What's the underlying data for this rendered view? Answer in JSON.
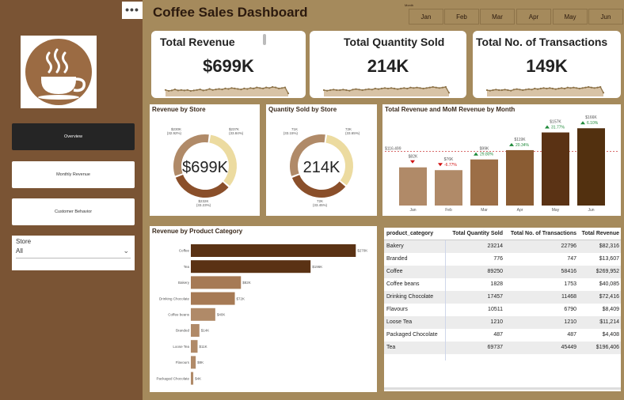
{
  "app": {
    "title": "Coffee Sales Dashboard"
  },
  "sidebar": {
    "menu_glyph": "•••",
    "logo_icon": "coffee-cup-icon",
    "nav": [
      {
        "label": "Overview",
        "active": true
      },
      {
        "label": "Monthly Revenue",
        "active": false
      },
      {
        "label": "Customer Behavior",
        "active": false
      }
    ],
    "store_filter": {
      "label": "Store",
      "value": "All"
    }
  },
  "month_slicer": {
    "label": "Month",
    "months": [
      "Jan",
      "Feb",
      "Mar",
      "Apr",
      "May",
      "Jun"
    ]
  },
  "kpis": [
    {
      "title": "Total Revenue",
      "value": "$699K"
    },
    {
      "title": "Total Quantity Sold",
      "value": "214K"
    },
    {
      "title": "Total No. of Transactions",
      "value": "149K"
    }
  ],
  "colors": {
    "dark": "#5a3214",
    "mid": "#8a4f2a",
    "light_brown": "#b08a68",
    "cream": "#ecdba0",
    "accent_bg": "#a58a5c",
    "sidebar": "#7a5434",
    "up": "#1f8a3a",
    "down": "#d01010"
  },
  "chart_data": [
    {
      "type": "pie",
      "title": "Revenue by Store",
      "center_label": "$699K",
      "slices": [
        {
          "value": 237,
          "label": "$237K",
          "pct_label": "(33.84%)"
        },
        {
          "value": 232,
          "label": "$232K",
          "pct_label": "(33.23%)"
        },
        {
          "value": 230,
          "label": "$230K",
          "pct_label": "(32.92%)"
        }
      ]
    },
    {
      "type": "pie",
      "title": "Quantity Sold by Store",
      "center_label": "214K",
      "slices": [
        {
          "value": 72,
          "label": "72K",
          "pct_label": "(33.65%)"
        },
        {
          "value": 72,
          "label": "72K",
          "pct_label": "(33.45%)"
        },
        {
          "value": 71,
          "label": "71K",
          "pct_label": "(33.15%)"
        }
      ]
    },
    {
      "type": "bar",
      "title": "Total Revenue and MoM Revenue by Month",
      "categories": [
        "Jan",
        "Feb",
        "Mar",
        "Apr",
        "May",
        "Jun"
      ],
      "values": [
        82,
        76,
        99,
        119,
        157,
        166
      ],
      "value_labels": [
        "$82K",
        "$76K",
        "$99K",
        "$119K",
        "$157K",
        "$166K"
      ],
      "mom": [
        {
          "dir": "down",
          "text": ""
        },
        {
          "dir": "down",
          "text": "-6.77%"
        },
        {
          "dir": "up",
          "text": "29.80%"
        },
        {
          "dir": "up",
          "text": "20.34%"
        },
        {
          "dir": "up",
          "text": "31.77%"
        },
        {
          "dir": "up",
          "text": "6.10%"
        }
      ],
      "reference_value": 116.499,
      "reference_label": "$116.499",
      "ylim": [
        0,
        180
      ]
    },
    {
      "type": "bar",
      "orientation": "horizontal",
      "title": "Revenue by Product Category",
      "categories": [
        "Coffee",
        "Tea",
        "Bakery",
        "Drinking Chocolate",
        "Coffee beans",
        "Branded",
        "Loose Tea",
        "Flavours",
        "Packaged Chocolate"
      ],
      "values": [
        270,
        196,
        82,
        72,
        40,
        14,
        11,
        8,
        4
      ],
      "value_labels": [
        "$270K",
        "$196K",
        "$82K",
        "$72K",
        "$40K",
        "$14K",
        "$11K",
        "$8K",
        "$4K"
      ],
      "xlim": [
        0,
        280
      ]
    },
    {
      "type": "line",
      "role": "kpi-sparkline",
      "kpi": "Total Revenue",
      "values": [
        10,
        8,
        9,
        11,
        9,
        10,
        9,
        10,
        8,
        9,
        10,
        11,
        9,
        10,
        12,
        10,
        11,
        12,
        11,
        13,
        12,
        14,
        13,
        12,
        11,
        13,
        12,
        14,
        13,
        15,
        14,
        13,
        15,
        14,
        16,
        15,
        13,
        14,
        15,
        3
      ]
    },
    {
      "type": "line",
      "role": "kpi-sparkline",
      "kpi": "Total Quantity Sold",
      "values": [
        9,
        8,
        9,
        10,
        9,
        9,
        10,
        9,
        8,
        10,
        11,
        10,
        9,
        10,
        11,
        10,
        12,
        11,
        12,
        13,
        12,
        13,
        12,
        11,
        12,
        13,
        12,
        14,
        13,
        14,
        13,
        12,
        13,
        14,
        15,
        14,
        13,
        14,
        15,
        4
      ]
    },
    {
      "type": "line",
      "role": "kpi-sparkline",
      "kpi": "Total No. of Transactions",
      "values": [
        9,
        8,
        9,
        10,
        9,
        9,
        10,
        9,
        8,
        10,
        11,
        10,
        9,
        10,
        11,
        10,
        12,
        11,
        12,
        13,
        12,
        13,
        12,
        11,
        12,
        13,
        12,
        14,
        13,
        14,
        13,
        12,
        13,
        14,
        15,
        14,
        13,
        14,
        15,
        4
      ]
    }
  ],
  "product_table": {
    "headers": [
      "product_category",
      "Total Quantity Sold",
      "Total No. of Transactions",
      "Total Revenue"
    ],
    "rows": [
      [
        "Bakery",
        "23214",
        "22796",
        "$82,316"
      ],
      [
        "Branded",
        "776",
        "747",
        "$13,607"
      ],
      [
        "Coffee",
        "89250",
        "58416",
        "$269,952"
      ],
      [
        "Coffee beans",
        "1828",
        "1753",
        "$40,085"
      ],
      [
        "Drinking Chocolate",
        "17457",
        "11468",
        "$72,416"
      ],
      [
        "Flavours",
        "10511",
        "6790",
        "$8,409"
      ],
      [
        "Loose Tea",
        "1210",
        "1210",
        "$11,214"
      ],
      [
        "Packaged Chocolate",
        "487",
        "487",
        "$4,408"
      ],
      [
        "Tea",
        "69737",
        "45449",
        "$196,406"
      ]
    ]
  }
}
